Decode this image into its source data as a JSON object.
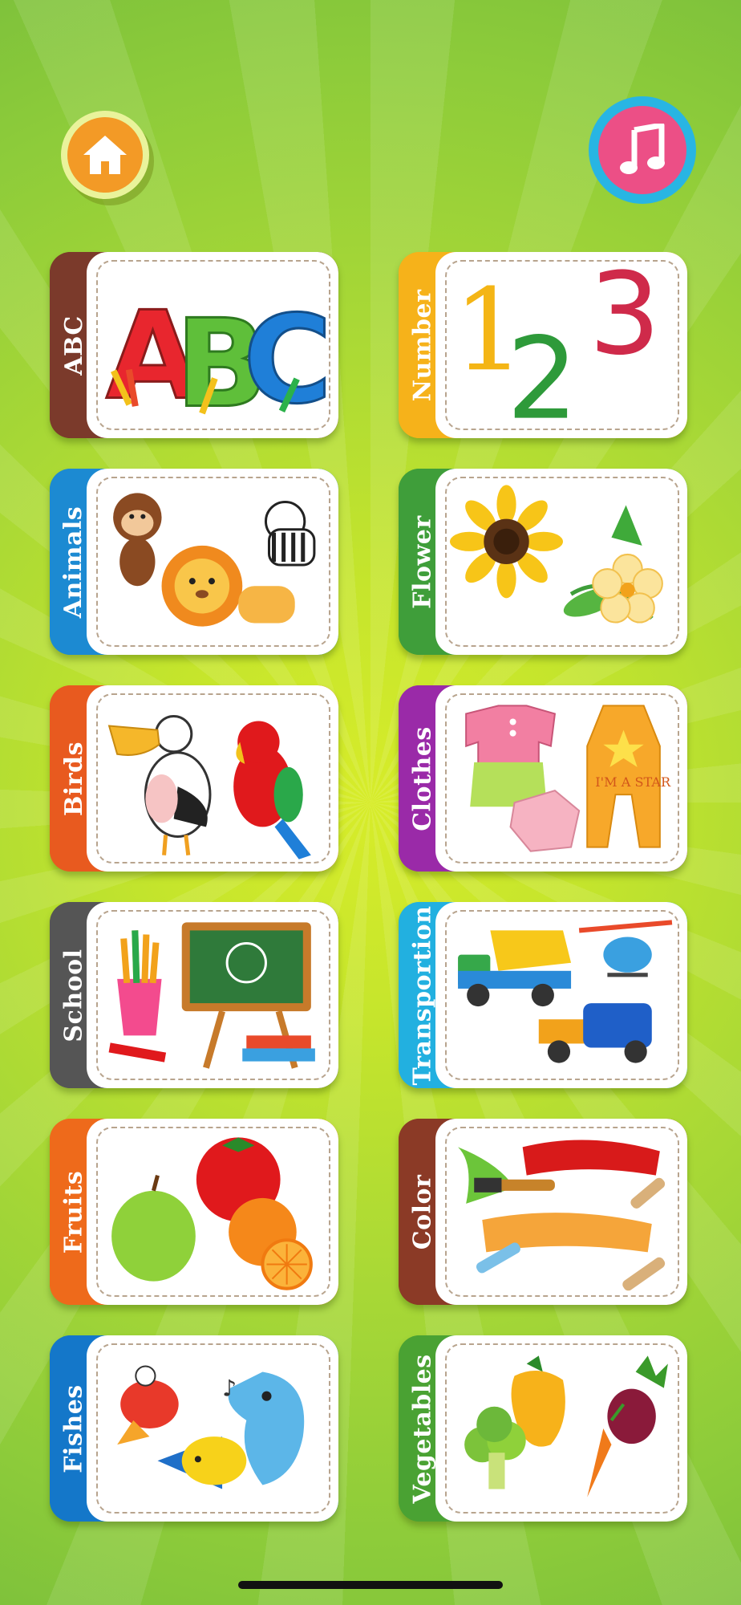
{
  "top_bar": {
    "home_icon": "home-icon",
    "music_icon": "music-note-icon"
  },
  "categories": [
    {
      "label": "ABC",
      "color": "#7b3a2b",
      "icon": "alphabet-letters-icon"
    },
    {
      "label": "Number",
      "color": "#f6b21a",
      "icon": "numbers-123-icon"
    },
    {
      "label": "Animals",
      "color": "#1c8ad2",
      "icon": "animals-icon"
    },
    {
      "label": "Flower",
      "color": "#3f9e3a",
      "icon": "flower-icon"
    },
    {
      "label": "Birds",
      "color": "#e85a1f",
      "icon": "birds-icon"
    },
    {
      "label": "Clothes",
      "color": "#9a2aa8",
      "icon": "clothes-icon"
    },
    {
      "label": "School",
      "color": "#555555",
      "icon": "school-supplies-icon"
    },
    {
      "label": "Transportion",
      "color": "#22b0e0",
      "icon": "vehicles-icon"
    },
    {
      "label": "Fruits",
      "color": "#ee6a1b",
      "icon": "fruits-icon"
    },
    {
      "label": "Color",
      "color": "#8b3a26",
      "icon": "paint-brush-icon"
    },
    {
      "label": "Fishes",
      "color": "#1477c9",
      "icon": "fish-icon"
    },
    {
      "label": "Vegetables",
      "color": "#4aa233",
      "icon": "vegetables-icon"
    }
  ]
}
